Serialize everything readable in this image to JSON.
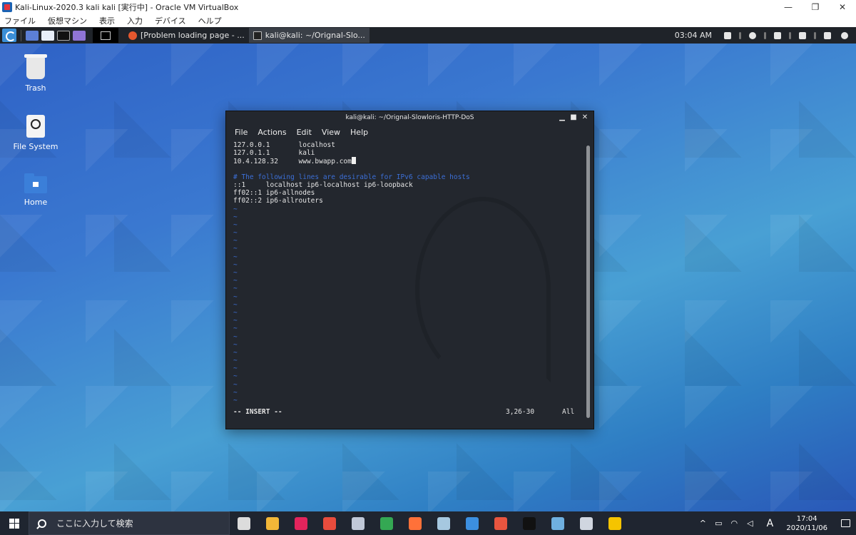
{
  "vbox": {
    "title": "Kali-Linux-2020.3 kali kali [実行中] - Oracle VM VirtualBox",
    "menu": [
      "ファイル",
      "仮想マシン",
      "表示",
      "入力",
      "デバイス",
      "ヘルプ"
    ],
    "controls": {
      "minimize": "—",
      "restore": "❐",
      "close": "✕"
    }
  },
  "kali_panel": {
    "tasks": [
      {
        "label": "[Problem loading page - ...",
        "icon": "firefox-icon"
      },
      {
        "label": "kali@kali: ~/Orignal-Slo...",
        "icon": "terminal-icon"
      }
    ],
    "clock": "03:04 AM"
  },
  "desktop": {
    "icons": [
      {
        "label": "Trash",
        "icon": "trash-icon"
      },
      {
        "label": "File System",
        "icon": "drive-icon"
      },
      {
        "label": "Home",
        "icon": "home-folder-icon"
      }
    ]
  },
  "terminal": {
    "title": "kali@kali: ~/Orignal-Slowloris-HTTP-DoS",
    "controls": {
      "minimize": "▁",
      "maximize": "■",
      "close": "✕"
    },
    "menu": [
      "File",
      "Actions",
      "Edit",
      "View",
      "Help"
    ],
    "lines": [
      "127.0.0.1       localhost",
      "127.0.1.1       kali",
      "10.4.128.32     www.bwapp.com",
      "",
      "# The following lines are desirable for IPv6 capable hosts",
      "::1     localhost ip6-localhost ip6-loopback",
      "ff02::1 ip6-allnodes",
      "ff02::2 ip6-allrouters"
    ],
    "tilde": "~",
    "tilde_count": 25,
    "status": {
      "mode": "-- INSERT --",
      "position": "3,26-30",
      "percent": "All"
    }
  },
  "win_taskbar": {
    "search_placeholder": "ここに入力して検索",
    "tray": {
      "up_arrow": "^",
      "ime": "A"
    },
    "time": "17:04",
    "date": "2020/11/06",
    "app_colors": [
      "#dcdcdc",
      "#f2b738",
      "#e3245c",
      "#e84c3d",
      "#c0c8d8",
      "#34a853",
      "#ff7139",
      "#a6c8e0",
      "#3c8fe0",
      "#e8553f",
      "#111111",
      "#6fb0e0",
      "#d0d6e0",
      "#f5c400"
    ]
  }
}
